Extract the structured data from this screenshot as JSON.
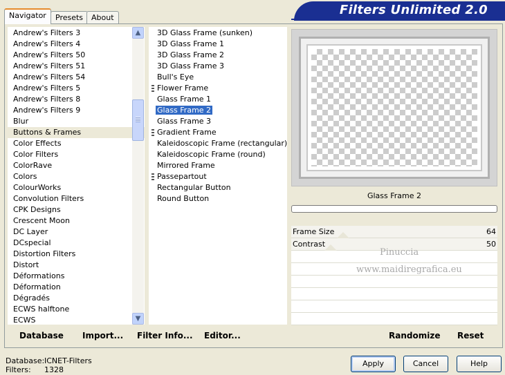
{
  "tabs": [
    "Navigator",
    "Presets",
    "About"
  ],
  "brand": "Filters Unlimited 2.0",
  "categories": [
    "Andrew's Filters 3",
    "Andrew's Filters 4",
    "Andrew's Filters 50",
    "Andrew's Filters 51",
    "Andrew's Filters 54",
    "Andrew's Filters 5",
    "Andrew's Filters 8",
    "Andrew's Filters 9",
    "Blur",
    "Buttons & Frames",
    "Color Effects",
    "Color Filters",
    "ColorRave",
    "Colors",
    "ColourWorks",
    "Convolution Filters",
    "CPK Designs",
    "Crescent Moon",
    "DC Layer",
    "DCspecial",
    "Distortion Filters",
    "Distort",
    "Déformations",
    "Déformation",
    "Dégradés",
    "ECWS halftone",
    "ECWS"
  ],
  "selected_category": "Buttons & Frames",
  "filters": [
    {
      "label": "3D Glass Frame (sunken)",
      "marked": false
    },
    {
      "label": "3D Glass Frame 1",
      "marked": false
    },
    {
      "label": "3D Glass Frame 2",
      "marked": false
    },
    {
      "label": "3D Glass Frame 3",
      "marked": false
    },
    {
      "label": "Bull's Eye",
      "marked": false
    },
    {
      "label": "Flower Frame",
      "marked": true
    },
    {
      "label": "Glass Frame 1",
      "marked": false
    },
    {
      "label": "Glass Frame 2",
      "marked": false
    },
    {
      "label": "Glass Frame 3",
      "marked": false
    },
    {
      "label": "Gradient Frame",
      "marked": true
    },
    {
      "label": "Kaleidoscopic Frame (rectangular)",
      "marked": false
    },
    {
      "label": "Kaleidoscopic Frame (round)",
      "marked": false
    },
    {
      "label": "Mirrored Frame",
      "marked": false
    },
    {
      "label": "Passepartout",
      "marked": true
    },
    {
      "label": "Rectangular Button",
      "marked": false
    },
    {
      "label": "Round Button",
      "marked": false
    }
  ],
  "selected_filter": "Glass Frame 2",
  "preview_filter_name": "Glass Frame 2",
  "params": [
    {
      "label": "Frame Size",
      "value": "64"
    },
    {
      "label": "Contrast",
      "value": "50"
    }
  ],
  "watermark": {
    "line1": "Pinuccia",
    "line2": "www.maidiregrafica.eu"
  },
  "toolbar": {
    "database": "Database",
    "import": "Import...",
    "filter_info": "Filter Info...",
    "editor": "Editor...",
    "randomize": "Randomize",
    "reset": "Reset"
  },
  "status": {
    "database_label": "Database:",
    "database_value": "ICNET-Filters",
    "filters_label": "Filters:",
    "filters_value": "1328"
  },
  "buttons": {
    "apply": "Apply",
    "cancel": "Cancel",
    "help": "Help"
  }
}
